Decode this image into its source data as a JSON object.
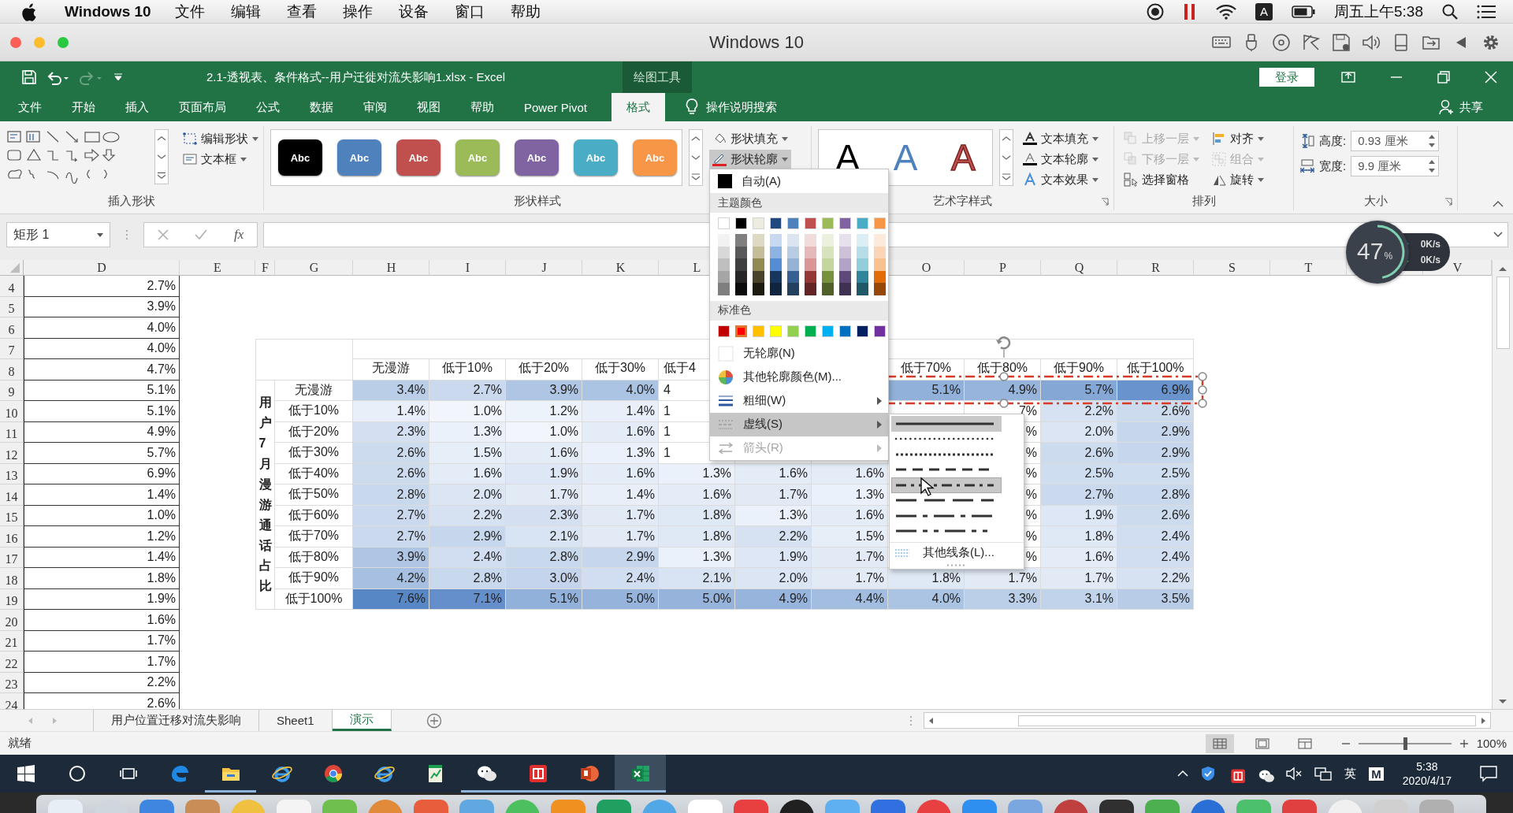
{
  "mac_menubar": {
    "app": "Windows 10",
    "menus": [
      "文件",
      "编辑",
      "查看",
      "操作",
      "设备",
      "窗口",
      "帮助"
    ],
    "input_source": "A",
    "clock": "周五上午5:38"
  },
  "vm_window": {
    "title": "Windows 10"
  },
  "excel": {
    "title": "2.1-透视表、条件格式--用户迁徙对流失影响1.xlsx - Excel",
    "context_label": "绘图工具",
    "sign_in": "登录",
    "tabs": [
      {
        "label": "文件",
        "selected": false
      },
      {
        "label": "开始",
        "selected": false
      },
      {
        "label": "插入",
        "selected": false
      },
      {
        "label": "页面布局",
        "selected": false
      },
      {
        "label": "公式",
        "selected": false
      },
      {
        "label": "数据",
        "selected": false
      },
      {
        "label": "审阅",
        "selected": false
      },
      {
        "label": "视图",
        "selected": false
      },
      {
        "label": "帮助",
        "selected": false
      },
      {
        "label": "Power Pivot",
        "selected": false
      },
      {
        "label": "格式",
        "selected": true
      }
    ],
    "tell_me": "操作说明搜索",
    "share": "共享"
  },
  "ribbon": {
    "insert_shapes": {
      "label": "插入形状",
      "buttons": [
        {
          "kind": "edit-shape",
          "label": "编辑形状"
        },
        {
          "kind": "text-box",
          "label": "文本框"
        }
      ]
    },
    "shape_styles": {
      "label": "形状样式",
      "swatches": [
        {
          "text": "Abc",
          "color": "#000000"
        },
        {
          "text": "Abc",
          "color": "#4f81bd"
        },
        {
          "text": "Abc",
          "color": "#c0504d"
        },
        {
          "text": "Abc",
          "color": "#9bbb59"
        },
        {
          "text": "Abc",
          "color": "#8064a2"
        },
        {
          "text": "Abc",
          "color": "#4bacc6"
        },
        {
          "text": "Abc",
          "color": "#f79646"
        }
      ],
      "buttons": [
        {
          "kind": "shape-fill",
          "label": "形状填充",
          "pressed": false
        },
        {
          "kind": "shape-outline",
          "label": "形状轮廓",
          "pressed": true
        }
      ]
    },
    "wordart": {
      "label": "艺术字样式",
      "letters": [
        {
          "text": "A",
          "kind": "fill",
          "color": "#000000"
        },
        {
          "text": "A",
          "kind": "fill",
          "color": "#4f81bd"
        },
        {
          "text": "A",
          "kind": "outline",
          "color": "#c0504d"
        }
      ],
      "buttons": [
        {
          "kind": "text-fill",
          "label": "文本填充"
        },
        {
          "kind": "text-outline",
          "label": "文本轮廓"
        },
        {
          "kind": "text-effects",
          "label": "文本效果"
        }
      ]
    },
    "arrange": {
      "label": "排列",
      "buttons": [
        {
          "kind": "bring-forward",
          "label": "上移一层",
          "disabled": true,
          "dropdown": true
        },
        {
          "kind": "send-backward",
          "label": "下移一层",
          "disabled": true,
          "dropdown": true
        },
        {
          "kind": "selection-pane",
          "label": "选择窗格",
          "disabled": false,
          "dropdown": false
        },
        {
          "kind": "align",
          "label": "对齐",
          "disabled": false,
          "dropdown": true
        },
        {
          "kind": "group",
          "label": "组合",
          "disabled": true,
          "dropdown": true
        },
        {
          "kind": "rotate",
          "label": "旋转",
          "disabled": false,
          "dropdown": true
        }
      ]
    },
    "size": {
      "label": "大小",
      "fields": [
        {
          "kind": "height",
          "label": "高度:",
          "value": "0.93 厘米"
        },
        {
          "kind": "width",
          "label": "宽度:",
          "value": "9.9 厘米"
        }
      ]
    }
  },
  "formula_bar": {
    "name_box": "矩形 1",
    "fx": "fx"
  },
  "sheet": {
    "columns": [
      "D",
      "E",
      "F",
      "G",
      "H",
      "I",
      "J",
      "K",
      "L",
      "O",
      "P",
      "Q",
      "R",
      "S",
      "T",
      "V"
    ],
    "row_numbers": [
      "4",
      "5",
      "6",
      "7",
      "8",
      "9",
      "10",
      "11",
      "12",
      "13",
      "14",
      "15",
      "16",
      "17",
      "18",
      "19",
      "20",
      "21",
      "22",
      "23",
      "24"
    ],
    "column_d": [
      "2.7%",
      "3.9%",
      "4.0%",
      "4.0%",
      "4.7%",
      "5.1%",
      "5.1%",
      "4.9%",
      "5.7%",
      "6.9%",
      "1.4%",
      "1.0%",
      "1.2%",
      "1.4%",
      "1.8%",
      "1.9%",
      "1.6%",
      "1.7%",
      "1.7%",
      "2.2%",
      "2.6%"
    ],
    "pivot": {
      "vertical_label": "用户7月漫游通话占比",
      "headers": {
        "H": "无漫游",
        "I": "低于10%",
        "J": "低于20%",
        "K": "低于30%",
        "L": "低于4",
        "O": "低于70%",
        "P": "低于80%",
        "Q": "低于90%",
        "R": "低于100%"
      },
      "rows": [
        {
          "label": "无漫游",
          "cells": {
            "H": "3.4%",
            "I": "2.7%",
            "J": "3.9%",
            "K": "4.0%",
            "L": "4",
            "O": "5.1%",
            "P": "4.9%",
            "Q": "5.7%",
            "R": "6.9%"
          }
        },
        {
          "label": "低于10%",
          "cells": {
            "H": "1.4%",
            "I": "1.0%",
            "J": "1.2%",
            "K": "1.4%",
            "L": "1",
            "P": "7%",
            "Q": "2.2%",
            "R": "2.6%"
          }
        },
        {
          "label": "低于20%",
          "cells": {
            "H": "2.3%",
            "I": "1.3%",
            "J": "1.0%",
            "K": "1.6%",
            "L": "1",
            "P": "%",
            "Q": "2.0%",
            "R": "2.9%"
          }
        },
        {
          "label": "低于30%",
          "cells": {
            "H": "2.6%",
            "I": "1.5%",
            "J": "1.6%",
            "K": "1.3%",
            "L": "1",
            "P": "%",
            "Q": "2.6%",
            "R": "2.9%"
          }
        },
        {
          "label": "低于40%",
          "cells": {
            "H": "2.6%",
            "I": "1.6%",
            "J": "1.9%",
            "K": "1.6%",
            "L": "1.3%",
            "M": "1.6%",
            "N": "1.6%",
            "P": "%",
            "Q": "2.5%",
            "R": "2.5%"
          }
        },
        {
          "label": "低于50%",
          "cells": {
            "H": "2.8%",
            "I": "2.0%",
            "J": "1.7%",
            "K": "1.4%",
            "L": "1.6%",
            "M": "1.7%",
            "N": "1.3%",
            "P": "%",
            "Q": "2.7%",
            "R": "2.8%"
          }
        },
        {
          "label": "低于60%",
          "cells": {
            "H": "2.7%",
            "I": "2.2%",
            "J": "2.3%",
            "K": "1.7%",
            "L": "1.8%",
            "M": "1.3%",
            "N": "1.6%",
            "P": "%",
            "Q": "1.9%",
            "R": "2.6%"
          }
        },
        {
          "label": "低于70%",
          "cells": {
            "H": "2.7%",
            "I": "2.9%",
            "J": "2.1%",
            "K": "1.7%",
            "L": "1.8%",
            "M": "2.2%",
            "N": "1.5%",
            "P": "%",
            "Q": "1.8%",
            "R": "2.4%"
          }
        },
        {
          "label": "低于80%",
          "cells": {
            "H": "3.9%",
            "I": "2.4%",
            "J": "2.8%",
            "K": "2.9%",
            "L": "1.3%",
            "M": "1.9%",
            "N": "1.7%",
            "P": "%",
            "Q": "1.6%",
            "R": "2.4%"
          }
        },
        {
          "label": "低于90%",
          "cells": {
            "H": "4.2%",
            "I": "2.8%",
            "J": "3.0%",
            "K": "2.4%",
            "L": "2.1%",
            "M": "2.0%",
            "N": "1.7%",
            "O": "1.8%",
            "P": "1.7%",
            "Q": "1.7%",
            "R": "2.2%"
          }
        },
        {
          "label": "低于100%",
          "cells": {
            "H": "7.6%",
            "I": "7.1%",
            "J": "5.1%",
            "K": "5.0%",
            "L": "5.0%",
            "M": "4.9%",
            "N": "4.4%",
            "O": "4.0%",
            "P": "3.3%",
            "Q": "3.1%",
            "R": "3.5%"
          }
        }
      ]
    }
  },
  "sheet_tabs": [
    {
      "label": "用户位置迁移对流失影响",
      "selected": false
    },
    {
      "label": "Sheet1",
      "selected": false
    },
    {
      "label": "演示",
      "selected": true
    }
  ],
  "status_bar": {
    "status": "就绪",
    "zoom": "100%",
    "zoom_slider": {
      "level": 0.5
    }
  },
  "outline_menu": {
    "items": [
      {
        "kind": "auto",
        "label": "自动(A)",
        "color": "#000000",
        "hovered": false,
        "disabled": false
      },
      {
        "kind": "header",
        "label": "主题颜色"
      },
      {
        "kind": "theme-grid",
        "base": [
          {
            "color": "#ffffff",
            "selected": false
          },
          {
            "color": "#000000",
            "selected": false
          },
          {
            "color": "#eeece1",
            "selected": false
          },
          {
            "color": "#1f497d",
            "selected": false
          },
          {
            "color": "#4f81bd",
            "selected": false
          },
          {
            "color": "#c0504d",
            "selected": false
          },
          {
            "color": "#9bbb59",
            "selected": false
          },
          {
            "color": "#8064a2",
            "selected": false
          },
          {
            "color": "#4bacc6",
            "selected": false
          },
          {
            "color": "#f79646",
            "selected": false
          }
        ],
        "shades": [
          [
            {
              "color": "#f2f2f2",
              "selected": false
            },
            {
              "color": "#7f7f7f",
              "selected": false
            },
            {
              "color": "#ddd9c3",
              "selected": false
            },
            {
              "color": "#c6d9f0",
              "selected": false
            },
            {
              "color": "#dbe5f1",
              "selected": false
            },
            {
              "color": "#f2dcdb",
              "selected": false
            },
            {
              "color": "#ebf1dd",
              "selected": false
            },
            {
              "color": "#e5e0ec",
              "selected": false
            },
            {
              "color": "#dbeef3",
              "selected": false
            },
            {
              "color": "#fdeada",
              "selected": false
            }
          ],
          [
            {
              "color": "#d8d8d8",
              "selected": false
            },
            {
              "color": "#595959",
              "selected": false
            },
            {
              "color": "#c4bd97",
              "selected": false
            },
            {
              "color": "#8db3e2",
              "selected": false
            },
            {
              "color": "#b8cce4",
              "selected": false
            },
            {
              "color": "#e5b9b7",
              "selected": false
            },
            {
              "color": "#d7e3bc",
              "selected": false
            },
            {
              "color": "#ccc1d9",
              "selected": false
            },
            {
              "color": "#b7dde8",
              "selected": false
            },
            {
              "color": "#fbd5b5",
              "selected": false
            }
          ],
          [
            {
              "color": "#bfbfbf",
              "selected": false
            },
            {
              "color": "#3f3f3f",
              "selected": false
            },
            {
              "color": "#938953",
              "selected": false
            },
            {
              "color": "#548dd4",
              "selected": false
            },
            {
              "color": "#95b3d7",
              "selected": false
            },
            {
              "color": "#d99694",
              "selected": false
            },
            {
              "color": "#c3d69b",
              "selected": false
            },
            {
              "color": "#b2a2c7",
              "selected": false
            },
            {
              "color": "#92cddc",
              "selected": false
            },
            {
              "color": "#fac08f",
              "selected": false
            }
          ],
          [
            {
              "color": "#a5a5a5",
              "selected": false
            },
            {
              "color": "#262626",
              "selected": false
            },
            {
              "color": "#494429",
              "selected": false
            },
            {
              "color": "#17365d",
              "selected": false
            },
            {
              "color": "#366092",
              "selected": false
            },
            {
              "color": "#953734",
              "selected": false
            },
            {
              "color": "#76923c",
              "selected": false
            },
            {
              "color": "#5f497a",
              "selected": false
            },
            {
              "color": "#31859b",
              "selected": false
            },
            {
              "color": "#e36c09",
              "selected": false
            }
          ],
          [
            {
              "color": "#7f7f7f",
              "selected": false
            },
            {
              "color": "#0c0c0c",
              "selected": false
            },
            {
              "color": "#1d1b10",
              "selected": false
            },
            {
              "color": "#0f243e",
              "selected": false
            },
            {
              "color": "#244061",
              "selected": false
            },
            {
              "color": "#632423",
              "selected": false
            },
            {
              "color": "#4f6128",
              "selected": false
            },
            {
              "color": "#3f3151",
              "selected": false
            },
            {
              "color": "#205867",
              "selected": false
            },
            {
              "color": "#974806",
              "selected": false
            }
          ]
        ]
      },
      {
        "kind": "header",
        "label": "标准色"
      },
      {
        "kind": "swatch-row",
        "swatches": [
          {
            "color": "#c00000",
            "selected": false
          },
          {
            "color": "#ff0000",
            "selected": true
          },
          {
            "color": "#ffc000",
            "selected": false
          },
          {
            "color": "#ffff00",
            "selected": false
          },
          {
            "color": "#92d050",
            "selected": false
          },
          {
            "color": "#00b050",
            "selected": false
          },
          {
            "color": "#00b0f0",
            "selected": false
          },
          {
            "color": "#0070c0",
            "selected": false
          },
          {
            "color": "#002060",
            "selected": false
          },
          {
            "color": "#7030a0",
            "selected": false
          }
        ]
      },
      {
        "kind": "no-outline",
        "label": "无轮廓(N)",
        "hovered": false,
        "disabled": false
      },
      {
        "kind": "more-colors",
        "label": "其他轮廓颜色(M)...",
        "hovered": false,
        "disabled": false
      },
      {
        "kind": "weight",
        "label": "粗细(W)",
        "hovered": false,
        "disabled": false
      },
      {
        "kind": "dashes",
        "label": "虚线(S)",
        "hovered": true,
        "disabled": false
      },
      {
        "kind": "arrows",
        "label": "箭头(R)",
        "hovered": false,
        "disabled": true
      }
    ]
  },
  "dash_submenu": {
    "options": [
      {
        "kind": "solid",
        "selected": true,
        "hovered": false
      },
      {
        "kind": "round-dot",
        "selected": false,
        "hovered": false
      },
      {
        "kind": "square-dot",
        "selected": false,
        "hovered": false
      },
      {
        "kind": "dash",
        "selected": false,
        "hovered": false
      },
      {
        "kind": "dash-dot",
        "selected": false,
        "hovered": true
      },
      {
        "kind": "long-dash",
        "selected": false,
        "hovered": false
      },
      {
        "kind": "long-dash-dot",
        "selected": false,
        "hovered": false
      },
      {
        "kind": "long-dash-dot-dot",
        "selected": false,
        "hovered": false
      }
    ],
    "more": "其他线条(L)..."
  },
  "net_monitor": {
    "percent": "47",
    "unit": "%",
    "upload": "0K/s",
    "download": "0K/s"
  },
  "taskbar": {
    "apps": [
      {
        "kind": "search",
        "running": false,
        "active": false
      },
      {
        "kind": "task-view",
        "running": false,
        "active": false
      },
      {
        "kind": "edge",
        "running": false,
        "active": false
      },
      {
        "kind": "explorer",
        "running": true,
        "active": false
      },
      {
        "kind": "ie",
        "running": false,
        "active": false
      },
      {
        "kind": "chrome",
        "running": false,
        "active": false
      },
      {
        "kind": "ie",
        "running": false,
        "active": false
      },
      {
        "kind": "notes",
        "running": false,
        "active": false
      },
      {
        "kind": "wechat",
        "running": true,
        "active": false
      },
      {
        "kind": "mail",
        "running": true,
        "active": false
      },
      {
        "kind": "powerpoint",
        "running": true,
        "active": false
      },
      {
        "kind": "excel",
        "running": true,
        "active": true
      }
    ],
    "language": "英",
    "ime": "M",
    "time": "5:38",
    "date": "2020/4/17"
  }
}
